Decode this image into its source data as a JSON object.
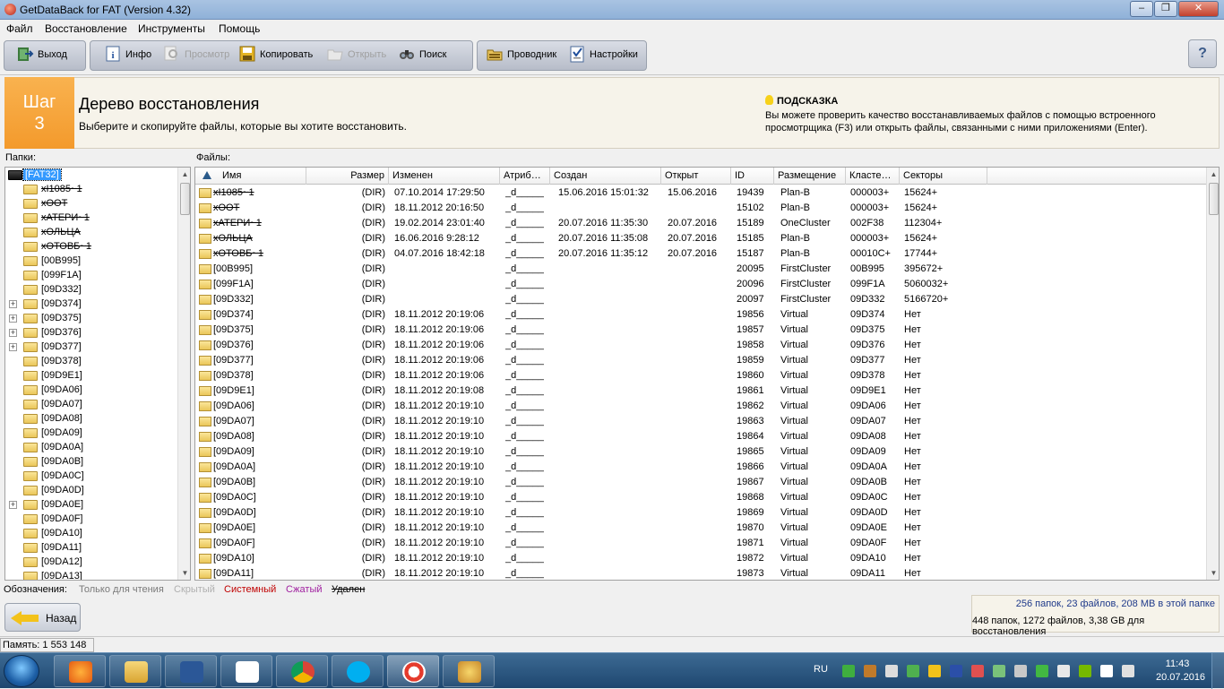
{
  "window": {
    "title": "GetDataBack for FAT (Version 4.32)"
  },
  "menu": [
    "Файл",
    "Восстановление",
    "Инструменты",
    "Помощь"
  ],
  "toolbar": {
    "exit": "Выход",
    "info": "Инфо",
    "view": "Просмотр",
    "copy": "Копировать",
    "open": "Открыть",
    "search": "Поиск",
    "explorer": "Проводник",
    "settings": "Настройки"
  },
  "step": {
    "label": "Шаг",
    "number": "3",
    "title": "Дерево восстановления",
    "description": "Выберите и скопируйте файлы, которые вы хотите восстановить."
  },
  "hint": {
    "title": "ПОДСКАЗКА",
    "text": "Вы можете проверить качество восстанавливаемых файлов с помощью встроенного просмотрщика (F3) или открыть файлы, связанными с ними приложениями (Enter)."
  },
  "folders_label": "Папки:",
  "files_label": "Файлы:",
  "tree": [
    {
      "name": "[FAT32]",
      "selected": true,
      "root": true
    },
    {
      "name": "xI1085~1",
      "deleted": true
    },
    {
      "name": "xOOT",
      "deleted": true
    },
    {
      "name": "xАТЕРИ~1",
      "deleted": true
    },
    {
      "name": "xОЛЬЦА",
      "deleted": true
    },
    {
      "name": "xОТОВБ~1",
      "deleted": true
    },
    {
      "name": "[00B995]"
    },
    {
      "name": "[099F1A]"
    },
    {
      "name": "[09D332]"
    },
    {
      "name": "[09D374]",
      "expand": true
    },
    {
      "name": "[09D375]",
      "expand": true
    },
    {
      "name": "[09D376]",
      "expand": true
    },
    {
      "name": "[09D377]",
      "expand": true
    },
    {
      "name": "[09D378]"
    },
    {
      "name": "[09D9E1]"
    },
    {
      "name": "[09DA06]"
    },
    {
      "name": "[09DA07]"
    },
    {
      "name": "[09DA08]"
    },
    {
      "name": "[09DA09]"
    },
    {
      "name": "[09DA0A]"
    },
    {
      "name": "[09DA0B]"
    },
    {
      "name": "[09DA0C]"
    },
    {
      "name": "[09DA0D]"
    },
    {
      "name": "[09DA0E]",
      "expand": true
    },
    {
      "name": "[09DA0F]"
    },
    {
      "name": "[09DA10]"
    },
    {
      "name": "[09DA11]"
    },
    {
      "name": "[09DA12]"
    },
    {
      "name": "[09DA13]"
    }
  ],
  "columns": [
    "Имя",
    "Размер",
    "Изменен",
    "Атриб…",
    "Создан",
    "Открыт",
    "ID",
    "Размещение",
    "Класте…",
    "Секторы"
  ],
  "files": [
    {
      "name": "xI1085~1",
      "size": "(DIR)",
      "modified": "07.10.2014 17:29:50",
      "attr": "_d_____",
      "created": "15.06.2016 15:01:32",
      "opened": "15.06.2016",
      "id": "19439",
      "place": "Plan-B",
      "cluster": "000003+",
      "sectors": "15624+",
      "deleted": true
    },
    {
      "name": "xOOT",
      "size": "(DIR)",
      "modified": "18.11.2012 20:16:50",
      "attr": "_d_____",
      "created": "",
      "opened": "",
      "id": "15102",
      "place": "Plan-B",
      "cluster": "000003+",
      "sectors": "15624+",
      "deleted": true
    },
    {
      "name": "xАТЕРИ~1",
      "size": "(DIR)",
      "modified": "19.02.2014 23:01:40",
      "attr": "_d_____",
      "created": "20.07.2016 11:35:30",
      "opened": "20.07.2016",
      "id": "15189",
      "place": "OneCluster",
      "cluster": "002F38",
      "sectors": "112304+",
      "deleted": true
    },
    {
      "name": "xОЛЬЦА",
      "size": "(DIR)",
      "modified": "16.06.2016 9:28:12",
      "attr": "_d_____",
      "created": "20.07.2016 11:35:08",
      "opened": "20.07.2016",
      "id": "15185",
      "place": "Plan-B",
      "cluster": "000003+",
      "sectors": "15624+",
      "deleted": true
    },
    {
      "name": "xОТОВБ~1",
      "size": "(DIR)",
      "modified": "04.07.2016 18:42:18",
      "attr": "_d_____",
      "created": "20.07.2016 11:35:12",
      "opened": "20.07.2016",
      "id": "15187",
      "place": "Plan-B",
      "cluster": "00010C+",
      "sectors": "17744+",
      "deleted": true
    },
    {
      "name": "[00B995]",
      "size": "(DIR)",
      "modified": "",
      "attr": "_d_____",
      "created": "",
      "opened": "",
      "id": "20095",
      "place": "FirstCluster",
      "cluster": "00B995",
      "sectors": "395672+"
    },
    {
      "name": "[099F1A]",
      "size": "(DIR)",
      "modified": "",
      "attr": "_d_____",
      "created": "",
      "opened": "",
      "id": "20096",
      "place": "FirstCluster",
      "cluster": "099F1A",
      "sectors": "5060032+"
    },
    {
      "name": "[09D332]",
      "size": "(DIR)",
      "modified": "",
      "attr": "_d_____",
      "created": "",
      "opened": "",
      "id": "20097",
      "place": "FirstCluster",
      "cluster": "09D332",
      "sectors": "5166720+"
    },
    {
      "name": "[09D374]",
      "size": "(DIR)",
      "modified": "18.11.2012 20:19:06",
      "attr": "_d_____",
      "created": "",
      "opened": "",
      "id": "19856",
      "place": "Virtual",
      "cluster": "09D374",
      "sectors": "Нет"
    },
    {
      "name": "[09D375]",
      "size": "(DIR)",
      "modified": "18.11.2012 20:19:06",
      "attr": "_d_____",
      "created": "",
      "opened": "",
      "id": "19857",
      "place": "Virtual",
      "cluster": "09D375",
      "sectors": "Нет"
    },
    {
      "name": "[09D376]",
      "size": "(DIR)",
      "modified": "18.11.2012 20:19:06",
      "attr": "_d_____",
      "created": "",
      "opened": "",
      "id": "19858",
      "place": "Virtual",
      "cluster": "09D376",
      "sectors": "Нет"
    },
    {
      "name": "[09D377]",
      "size": "(DIR)",
      "modified": "18.11.2012 20:19:06",
      "attr": "_d_____",
      "created": "",
      "opened": "",
      "id": "19859",
      "place": "Virtual",
      "cluster": "09D377",
      "sectors": "Нет"
    },
    {
      "name": "[09D378]",
      "size": "(DIR)",
      "modified": "18.11.2012 20:19:06",
      "attr": "_d_____",
      "created": "",
      "opened": "",
      "id": "19860",
      "place": "Virtual",
      "cluster": "09D378",
      "sectors": "Нет"
    },
    {
      "name": "[09D9E1]",
      "size": "(DIR)",
      "modified": "18.11.2012 20:19:08",
      "attr": "_d_____",
      "created": "",
      "opened": "",
      "id": "19861",
      "place": "Virtual",
      "cluster": "09D9E1",
      "sectors": "Нет"
    },
    {
      "name": "[09DA06]",
      "size": "(DIR)",
      "modified": "18.11.2012 20:19:10",
      "attr": "_d_____",
      "created": "",
      "opened": "",
      "id": "19862",
      "place": "Virtual",
      "cluster": "09DA06",
      "sectors": "Нет"
    },
    {
      "name": "[09DA07]",
      "size": "(DIR)",
      "modified": "18.11.2012 20:19:10",
      "attr": "_d_____",
      "created": "",
      "opened": "",
      "id": "19863",
      "place": "Virtual",
      "cluster": "09DA07",
      "sectors": "Нет"
    },
    {
      "name": "[09DA08]",
      "size": "(DIR)",
      "modified": "18.11.2012 20:19:10",
      "attr": "_d_____",
      "created": "",
      "opened": "",
      "id": "19864",
      "place": "Virtual",
      "cluster": "09DA08",
      "sectors": "Нет"
    },
    {
      "name": "[09DA09]",
      "size": "(DIR)",
      "modified": "18.11.2012 20:19:10",
      "attr": "_d_____",
      "created": "",
      "opened": "",
      "id": "19865",
      "place": "Virtual",
      "cluster": "09DA09",
      "sectors": "Нет"
    },
    {
      "name": "[09DA0A]",
      "size": "(DIR)",
      "modified": "18.11.2012 20:19:10",
      "attr": "_d_____",
      "created": "",
      "opened": "",
      "id": "19866",
      "place": "Virtual",
      "cluster": "09DA0A",
      "sectors": "Нет"
    },
    {
      "name": "[09DA0B]",
      "size": "(DIR)",
      "modified": "18.11.2012 20:19:10",
      "attr": "_d_____",
      "created": "",
      "opened": "",
      "id": "19867",
      "place": "Virtual",
      "cluster": "09DA0B",
      "sectors": "Нет"
    },
    {
      "name": "[09DA0C]",
      "size": "(DIR)",
      "modified": "18.11.2012 20:19:10",
      "attr": "_d_____",
      "created": "",
      "opened": "",
      "id": "19868",
      "place": "Virtual",
      "cluster": "09DA0C",
      "sectors": "Нет"
    },
    {
      "name": "[09DA0D]",
      "size": "(DIR)",
      "modified": "18.11.2012 20:19:10",
      "attr": "_d_____",
      "created": "",
      "opened": "",
      "id": "19869",
      "place": "Virtual",
      "cluster": "09DA0D",
      "sectors": "Нет"
    },
    {
      "name": "[09DA0E]",
      "size": "(DIR)",
      "modified": "18.11.2012 20:19:10",
      "attr": "_d_____",
      "created": "",
      "opened": "",
      "id": "19870",
      "place": "Virtual",
      "cluster": "09DA0E",
      "sectors": "Нет"
    },
    {
      "name": "[09DA0F]",
      "size": "(DIR)",
      "modified": "18.11.2012 20:19:10",
      "attr": "_d_____",
      "created": "",
      "opened": "",
      "id": "19871",
      "place": "Virtual",
      "cluster": "09DA0F",
      "sectors": "Нет"
    },
    {
      "name": "[09DA10]",
      "size": "(DIR)",
      "modified": "18.11.2012 20:19:10",
      "attr": "_d_____",
      "created": "",
      "opened": "",
      "id": "19872",
      "place": "Virtual",
      "cluster": "09DA10",
      "sectors": "Нет"
    },
    {
      "name": "[09DA11]",
      "size": "(DIR)",
      "modified": "18.11.2012 20:19:10",
      "attr": "_d_____",
      "created": "",
      "opened": "",
      "id": "19873",
      "place": "Virtual",
      "cluster": "09DA11",
      "sectors": "Нет"
    }
  ],
  "legend": {
    "label": "Обозначения:",
    "readonly": "Только для чтения",
    "hidden": "Скрытый",
    "system": "Системный",
    "compressed": "Сжатый",
    "deleted": "Удален"
  },
  "back_button": "Назад",
  "summary": {
    "line1": "256 папок, 23 файлов, 208 MB в этой папке",
    "line2": "448 папок, 1272 файлов, 3,38 GB для восстановления"
  },
  "status": {
    "memory": "Память: 1 553 148"
  },
  "taskbar": {
    "lang": "RU",
    "time": "11:43",
    "date": "20.07.2016"
  },
  "colors": {
    "stepOrange": "#f39a2c",
    "selection": "#3399ff",
    "legendSystem": "#c00000",
    "legendCompressed": "#a020a0",
    "summaryBlue": "#1f3a8a"
  }
}
